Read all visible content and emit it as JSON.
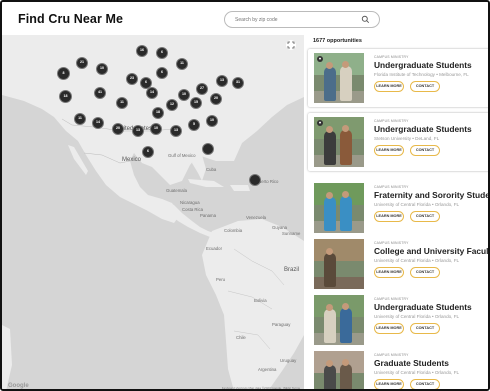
{
  "header": {
    "brand": "Find Cru Near Me",
    "search_placeholder": "Search by zip code"
  },
  "map": {
    "labels": [
      {
        "text": "United States"
      },
      {
        "text": "Mexico"
      },
      {
        "text": "Cuba"
      },
      {
        "text": "Puerto Rico"
      },
      {
        "text": "Guatemala"
      },
      {
        "text": "Nicaragua"
      },
      {
        "text": "Costa Rica"
      },
      {
        "text": "Panama"
      },
      {
        "text": "Venezuela"
      },
      {
        "text": "Colombia"
      },
      {
        "text": "Guyana"
      },
      {
        "text": "Suriname"
      },
      {
        "text": "Ecuador"
      },
      {
        "text": "Peru"
      },
      {
        "text": "Brazil"
      },
      {
        "text": "Bolivia"
      },
      {
        "text": "Paraguay"
      },
      {
        "text": "Chile"
      },
      {
        "text": "Uruguay"
      },
      {
        "text": "Argentina"
      },
      {
        "text": "Gulf of Mexico"
      }
    ],
    "clusters": [
      "16",
      "6",
      "21",
      "11",
      "10",
      "8",
      "6",
      "23",
      "6",
      "13",
      "31",
      "27",
      "41",
      "14",
      "10",
      "18",
      "11",
      "12",
      "15",
      "20",
      "18",
      "11",
      "14",
      "20",
      "13",
      "10",
      "13",
      "5",
      "10",
      "6"
    ],
    "google_mark": "Google",
    "attribution": "Keyboard shortcuts   Map data ©2023 Google, INEGI   Terms"
  },
  "list": {
    "count": "1677 opportunities",
    "kicker": "CAMPUS MINISTRY",
    "learn_label": "LEARN MORE",
    "contact_label": "CONTACT",
    "cards": [
      {
        "title": "Undergraduate Students",
        "subtitle": "Florida Institute of Technology • Melbourne, FL"
      },
      {
        "title": "Undergraduate Students",
        "subtitle": "Stetson University • DeLand, FL"
      },
      {
        "title": "Fraternity and Sorority Students",
        "subtitle": "University of Central Florida • Orlando, FL"
      },
      {
        "title": "College and University Faculty",
        "subtitle": "University of Central Florida • Orlando, FL"
      },
      {
        "title": "Undergraduate Students",
        "subtitle": "University of Central Florida • Orlando, FL"
      },
      {
        "title": "Graduate Students",
        "subtitle": "University of Central Florida • Orlando, FL"
      }
    ]
  },
  "icons": {
    "search": "search-icon",
    "fullscreen": "fullscreen-icon",
    "heart": "heart-icon",
    "pin": "map-pin-icon"
  },
  "colors": {
    "accent": "#e8b94a",
    "map_water": "#d5d5d5",
    "map_land": "#ececec",
    "cluster": "#2a2a2a"
  }
}
